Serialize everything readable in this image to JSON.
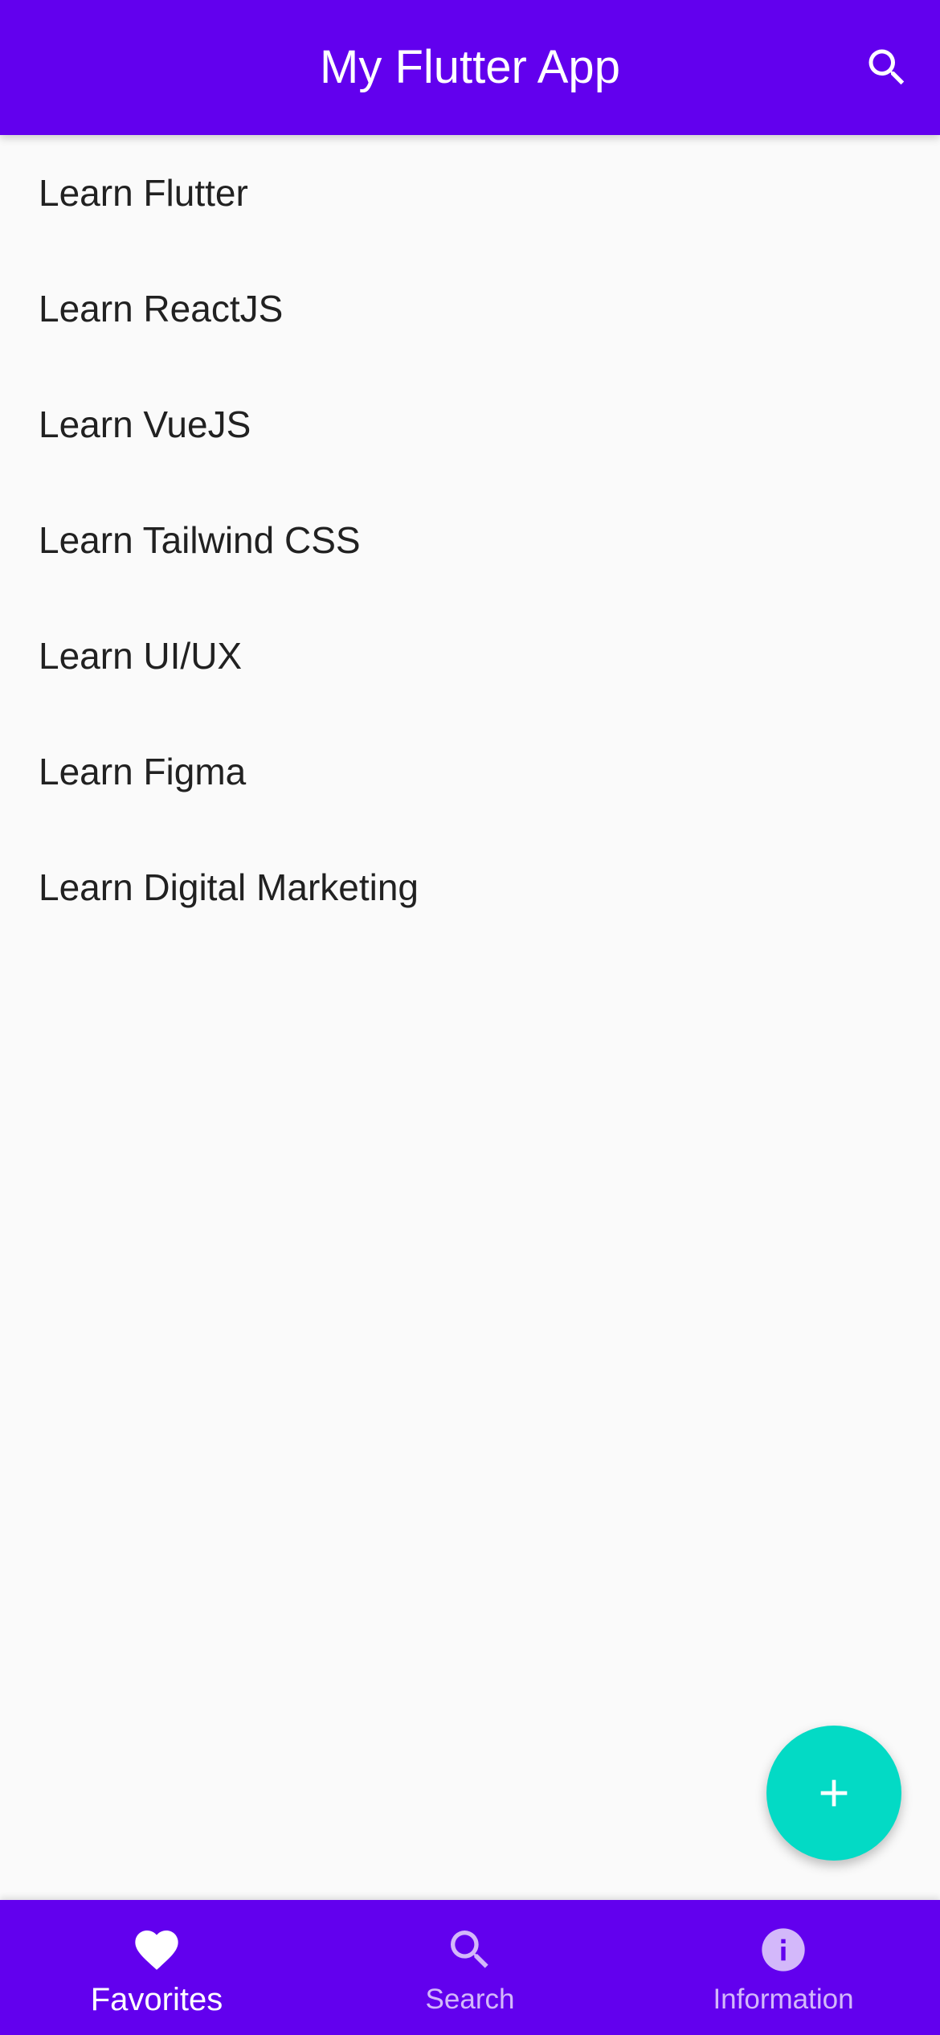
{
  "app_bar": {
    "title": "My Flutter App",
    "search_icon": "search-icon"
  },
  "list": {
    "items": [
      {
        "label": "Learn Flutter"
      },
      {
        "label": "Learn ReactJS"
      },
      {
        "label": "Learn VueJS"
      },
      {
        "label": "Learn Tailwind CSS"
      },
      {
        "label": "Learn UI/UX"
      },
      {
        "label": "Learn Figma"
      },
      {
        "label": "Learn Digital Marketing"
      }
    ]
  },
  "fab": {
    "icon": "plus-icon",
    "color": "#03dac5"
  },
  "bottom_nav": {
    "items": [
      {
        "label": "Favorites",
        "icon": "heart-icon",
        "active": true
      },
      {
        "label": "Search",
        "icon": "search-icon",
        "active": false
      },
      {
        "label": "Information",
        "icon": "info-icon",
        "active": false
      }
    ]
  },
  "colors": {
    "primary": "#6200ee",
    "accent": "#03dac5",
    "background": "#fafafa",
    "text": "#212121"
  }
}
